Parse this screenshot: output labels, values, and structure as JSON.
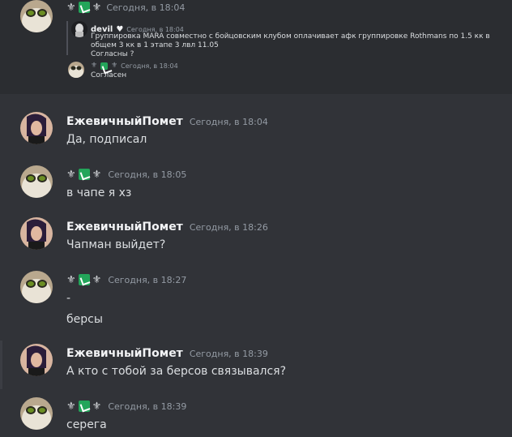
{
  "top_block": {
    "header_time": "Сегодня, в 18:04",
    "reply": {
      "name": "devil",
      "time": "Сегодня, в 18:04",
      "line1": "Группировка MARA совместно с бойцовским клубом оплачивает афк группировке Rothmans по 1.5 кк в общем 3 кк в 1 этапе 3 лвл 11.05",
      "line2": "Согласны ?"
    },
    "inner": {
      "time": "Сегодня, в 18:04",
      "text": "Согласен"
    }
  },
  "messages": [
    {
      "user": "ЕжевичныйПомет",
      "time": "Сегодня, в 18:04",
      "text": "Да, подписал",
      "avatar": "woman-avatar"
    },
    {
      "user": "",
      "time": "Сегодня, в 18:05",
      "text": "в чапе я хз",
      "avatar": "cat-avatar"
    },
    {
      "user": "ЕжевичныйПомет",
      "time": "Сегодня, в 18:26",
      "text": "Чапман выйдет?",
      "avatar": "woman-avatar"
    },
    {
      "user": "",
      "time": "Сегодня, в 18:27",
      "text": "-",
      "text2": "берсы",
      "avatar": "cat-avatar"
    },
    {
      "user": "ЕжевичныйПомет",
      "time": "Сегодня, в 18:39",
      "text": "А кто с тобой за берсов связывался?",
      "avatar": "woman-avatar"
    },
    {
      "user": "",
      "time": "Сегодня, в 18:39",
      "text": "серега",
      "avatar": "cat-avatar"
    }
  ],
  "badge_symbols": {
    "left": "⚜",
    "right": "⚜"
  },
  "colors": {
    "background": "#313338",
    "embed_bg": "#2b2d31",
    "green_badge": "#23a55a",
    "timestamp": "#949ba4"
  }
}
